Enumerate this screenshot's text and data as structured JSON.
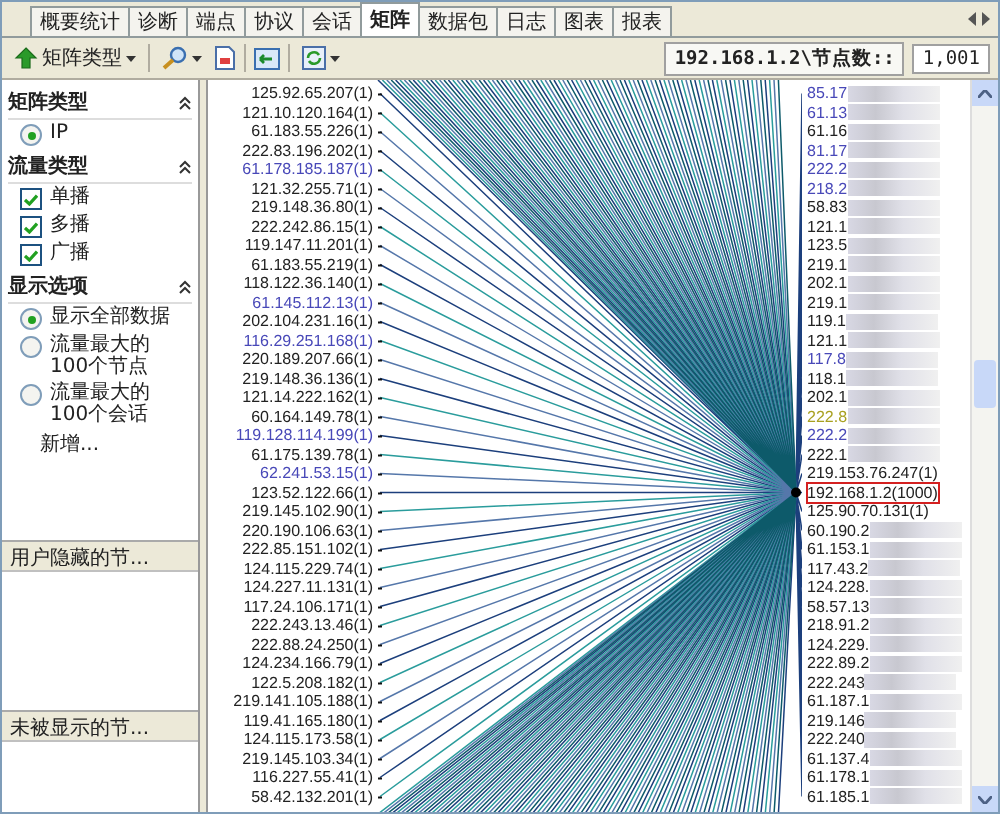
{
  "tabs": [
    {
      "label": "概要统计",
      "selected": false
    },
    {
      "label": "诊断",
      "selected": false
    },
    {
      "label": "端点",
      "selected": false
    },
    {
      "label": "协议",
      "selected": false
    },
    {
      "label": "会话",
      "selected": false
    },
    {
      "label": "矩阵",
      "selected": true
    },
    {
      "label": "数据包",
      "selected": false
    },
    {
      "label": "日志",
      "selected": false
    },
    {
      "label": "图表",
      "selected": false
    },
    {
      "label": "报表",
      "selected": false
    }
  ],
  "toolbar": {
    "matrix_type_button": "矩阵类型",
    "node_label": "192.168.1.2\\节点数::",
    "node_count": "1,001"
  },
  "sidebar": {
    "sections": [
      {
        "title": "矩阵类型",
        "items": [
          {
            "kind": "radio",
            "label": "IP",
            "selected": true
          }
        ]
      },
      {
        "title": "流量类型",
        "items": [
          {
            "kind": "checkbox",
            "label": "单播",
            "checked": true
          },
          {
            "kind": "checkbox",
            "label": "多播",
            "checked": true
          },
          {
            "kind": "checkbox",
            "label": "广播",
            "checked": true
          }
        ]
      },
      {
        "title": "显示选项",
        "items": [
          {
            "kind": "radio",
            "label": "显示全部数据",
            "selected": true
          },
          {
            "kind": "radio",
            "label": "流量最大的100个节点",
            "selected": false
          },
          {
            "kind": "radio",
            "label": "流量最大的100个会话",
            "selected": false
          },
          {
            "kind": "link",
            "label": "新增..."
          }
        ]
      }
    ],
    "panels": [
      "用户隐藏的节...",
      "未被显示的节..."
    ]
  },
  "matrix": {
    "left_nodes": [
      {
        "label": "125.92.65.207(1)",
        "color": "#222222"
      },
      {
        "label": "121.10.120.164(1)",
        "color": "#222222"
      },
      {
        "label": "61.183.55.226(1)",
        "color": "#222222"
      },
      {
        "label": "222.83.196.202(1)",
        "color": "#222222"
      },
      {
        "label": "61.178.185.187(1)",
        "color": "#4848b8"
      },
      {
        "label": "121.32.255.71(1)",
        "color": "#222222"
      },
      {
        "label": "219.148.36.80(1)",
        "color": "#222222"
      },
      {
        "label": "222.242.86.15(1)",
        "color": "#222222"
      },
      {
        "label": "119.147.11.201(1)",
        "color": "#222222"
      },
      {
        "label": "61.183.55.219(1)",
        "color": "#222222"
      },
      {
        "label": "118.122.36.140(1)",
        "color": "#222222"
      },
      {
        "label": "61.145.112.13(1)",
        "color": "#4848b8"
      },
      {
        "label": "202.104.231.16(1)",
        "color": "#222222"
      },
      {
        "label": "116.29.251.168(1)",
        "color": "#4848b8"
      },
      {
        "label": "220.189.207.66(1)",
        "color": "#222222"
      },
      {
        "label": "219.148.36.136(1)",
        "color": "#222222"
      },
      {
        "label": "121.14.222.162(1)",
        "color": "#222222"
      },
      {
        "label": "60.164.149.78(1)",
        "color": "#222222"
      },
      {
        "label": "119.128.114.199(1)",
        "color": "#4848b8"
      },
      {
        "label": "61.175.139.78(1)",
        "color": "#222222"
      },
      {
        "label": "62.241.53.15(1)",
        "color": "#4848b8"
      },
      {
        "label": "123.52.122.66(1)",
        "color": "#222222"
      },
      {
        "label": "219.145.102.90(1)",
        "color": "#222222"
      },
      {
        "label": "220.190.106.63(1)",
        "color": "#222222"
      },
      {
        "label": "222.85.151.102(1)",
        "color": "#222222"
      },
      {
        "label": "124.115.229.74(1)",
        "color": "#222222"
      },
      {
        "label": "124.227.11.131(1)",
        "color": "#222222"
      },
      {
        "label": "117.24.106.171(1)",
        "color": "#222222"
      },
      {
        "label": "222.243.13.46(1)",
        "color": "#222222"
      },
      {
        "label": "222.88.24.250(1)",
        "color": "#222222"
      },
      {
        "label": "124.234.166.79(1)",
        "color": "#222222"
      },
      {
        "label": "122.5.208.182(1)",
        "color": "#222222"
      },
      {
        "label": "219.141.105.188(1)",
        "color": "#222222"
      },
      {
        "label": "119.41.165.180(1)",
        "color": "#222222"
      },
      {
        "label": "124.115.173.58(1)",
        "color": "#222222"
      },
      {
        "label": "219.145.103.34(1)",
        "color": "#222222"
      },
      {
        "label": "116.227.55.41(1)",
        "color": "#222222"
      },
      {
        "label": "58.42.132.201(1)",
        "color": "#222222"
      }
    ],
    "right_nodes": [
      {
        "label": "85.17",
        "color": "#4848b8",
        "redacted": true,
        "highlighted": false
      },
      {
        "label": "61.13",
        "color": "#4848b8",
        "redacted": true,
        "highlighted": false
      },
      {
        "label": "61.16",
        "color": "#222222",
        "redacted": true,
        "highlighted": false
      },
      {
        "label": "81.17",
        "color": "#4848b8",
        "redacted": true,
        "highlighted": false
      },
      {
        "label": "222.2",
        "color": "#4848b8",
        "redacted": true,
        "highlighted": false
      },
      {
        "label": "218.2",
        "color": "#4848b8",
        "redacted": true,
        "highlighted": false
      },
      {
        "label": "58.83",
        "color": "#222222",
        "redacted": true,
        "highlighted": false
      },
      {
        "label": "121.1",
        "color": "#222222",
        "redacted": true,
        "highlighted": false
      },
      {
        "label": "123.5",
        "color": "#222222",
        "redacted": true,
        "highlighted": false
      },
      {
        "label": "219.1",
        "color": "#222222",
        "redacted": true,
        "highlighted": false
      },
      {
        "label": "202.1",
        "color": "#222222",
        "redacted": true,
        "highlighted": false
      },
      {
        "label": "219.1",
        "color": "#222222",
        "redacted": true,
        "highlighted": false
      },
      {
        "label": "119.1",
        "color": "#222222",
        "redacted": true,
        "highlighted": false
      },
      {
        "label": "121.1",
        "color": "#222222",
        "redacted": true,
        "highlighted": false
      },
      {
        "label": "117.8",
        "color": "#4848b8",
        "redacted": true,
        "highlighted": false
      },
      {
        "label": "118.1",
        "color": "#222222",
        "redacted": true,
        "highlighted": false
      },
      {
        "label": "202.1",
        "color": "#222222",
        "redacted": true,
        "highlighted": false
      },
      {
        "label": "222.8",
        "color": "#a8a020",
        "redacted": true,
        "highlighted": false
      },
      {
        "label": "222.2",
        "color": "#4848b8",
        "redacted": true,
        "highlighted": false
      },
      {
        "label": "222.1",
        "color": "#222222",
        "redacted": true,
        "highlighted": false
      },
      {
        "label": "219.153.76.247(1)",
        "color": "#222222",
        "redacted": false,
        "highlighted": false
      },
      {
        "label": "192.168.1.2(1000)",
        "color": "#222222",
        "redacted": false,
        "highlighted": true
      },
      {
        "label": "125.90.70.131(1)",
        "color": "#222222",
        "redacted": false,
        "highlighted": false
      },
      {
        "label": "60.190.2",
        "color": "#222222",
        "redacted": true,
        "highlighted": false
      },
      {
        "label": "61.153.1",
        "color": "#222222",
        "redacted": true,
        "highlighted": false
      },
      {
        "label": "117.43.2",
        "color": "#222222",
        "redacted": true,
        "highlighted": false
      },
      {
        "label": "124.228.",
        "color": "#222222",
        "redacted": true,
        "highlighted": false
      },
      {
        "label": "58.57.13",
        "color": "#222222",
        "redacted": true,
        "highlighted": false
      },
      {
        "label": "218.91.2",
        "color": "#222222",
        "redacted": true,
        "highlighted": false
      },
      {
        "label": "124.229.",
        "color": "#222222",
        "redacted": true,
        "highlighted": false
      },
      {
        "label": "222.89.2",
        "color": "#222222",
        "redacted": true,
        "highlighted": false
      },
      {
        "label": "222.243",
        "color": "#222222",
        "redacted": true,
        "highlighted": false
      },
      {
        "label": "61.187.1",
        "color": "#222222",
        "redacted": true,
        "highlighted": false
      },
      {
        "label": "219.146",
        "color": "#222222",
        "redacted": true,
        "highlighted": false
      },
      {
        "label": "222.240",
        "color": "#222222",
        "redacted": true,
        "highlighted": false
      },
      {
        "label": "61.137.4",
        "color": "#222222",
        "redacted": true,
        "highlighted": false
      },
      {
        "label": "61.178.1",
        "color": "#222222",
        "redacted": true,
        "highlighted": false
      },
      {
        "label": "61.185.1",
        "color": "#222222",
        "redacted": true,
        "highlighted": false
      }
    ]
  }
}
